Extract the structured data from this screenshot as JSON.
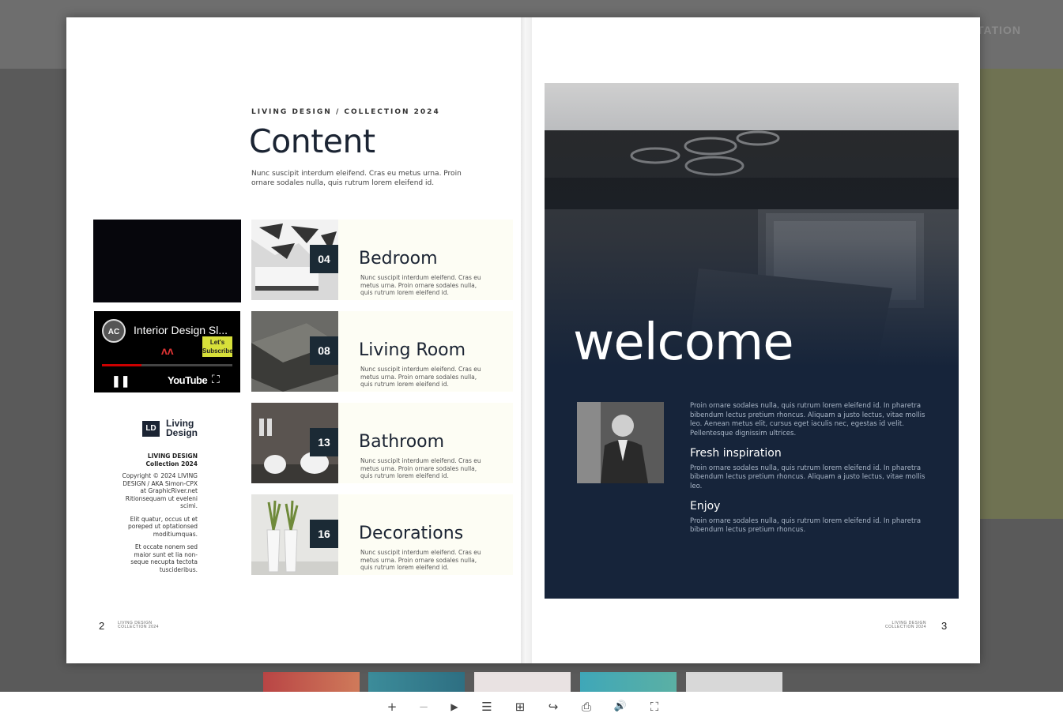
{
  "background": {
    "nav_text": "TATION"
  },
  "left_page": {
    "eyebrow": "LIVING DESIGN / COLLECTION 2024",
    "title": "Content",
    "intro": "Nunc suscipit interdum eleifend. Cras eu metus urna. Proin ornare sodales nulla, quis rutrum lorem eleifend id.",
    "video": {
      "channel_badge": "AC",
      "title": "Interior Design Sl...",
      "subscribe_label": "Let's Subscribe",
      "logo": "YouTube",
      "progress": 0.3
    },
    "brand": {
      "mark": "LD",
      "name_line1": "Living",
      "name_line2": "Design"
    },
    "colophon": {
      "head_line1": "LIVING DESIGN",
      "head_line2": "Collection 2024",
      "p1": "Copyright © 2024 LIVING DESIGN / AKA Simon-CPX at GraphicRiver.net Ritionsequam ut eveleni scimi.",
      "p2": "Elit quatur, occus ut et poreped ut optationsed moditiumquas.",
      "p3": "Et occate nonem sed maior sunt et lia non-seque necupta tectota tuscideribus."
    },
    "page_number": "2",
    "folio_line1": "LIVING DESIGN",
    "folio_line2": "COLLECTION 2024",
    "entries": [
      {
        "num": "04",
        "title": "Bedroom",
        "desc": "Nunc suscipit interdum eleifend. Cras eu metus urna. Proin ornare sodales nulla, quis rutrum lorem eleifend id."
      },
      {
        "num": "08",
        "title": "Living Room",
        "desc": "Nunc suscipit interdum eleifend. Cras eu metus urna. Proin ornare sodales nulla, quis rutrum lorem eleifend id."
      },
      {
        "num": "13",
        "title": "Bathroom",
        "desc": "Nunc suscipit interdum eleifend. Cras eu metus urna. Proin ornare sodales nulla, quis rutrum lorem eleifend id."
      },
      {
        "num": "16",
        "title": "Decorations",
        "desc": "Nunc suscipit interdum eleifend. Cras eu metus urna. Proin ornare sodales nulla, quis rutrum lorem eleifend id."
      }
    ]
  },
  "right_page": {
    "welcome": "welcome",
    "intro": "Proin ornare sodales nulla, quis rutrum lorem eleifend id. In pharetra bibendum lectus pretium rhoncus. Aliquam a justo lectus, vitae mollis leo. Aenean metus elit, cursus eget iaculis nec, egestas id velit. Pellentesque dignissim ultrices.",
    "h1": "Fresh inspiration",
    "p1": "Proin ornare sodales nulla, quis rutrum lorem eleifend id. In pharetra bibendum lectus pretium rhoncus. Aliquam a justo lectus, vitae mollis leo.",
    "h2": "Enjoy",
    "p2": "Proin ornare sodales nulla, quis rutrum lorem eleifend id. In pharetra bibendum lectus pretium rhoncus.",
    "page_number": "3",
    "folio_line1": "LIVING DESIGN",
    "folio_line2": "COLLECTION 2024"
  },
  "toolbar": {
    "zoom_in": "+",
    "zoom_out": "−",
    "play": "▶",
    "toc": "☰",
    "thumbnails": "⊞",
    "share": "↪",
    "print": "⎙",
    "sound": "🔊",
    "fullscreen": "⛶"
  },
  "colors": {
    "navy": "#16243a",
    "accent_bg": "#6f7252",
    "entry_bg": "#fdfdf4"
  }
}
